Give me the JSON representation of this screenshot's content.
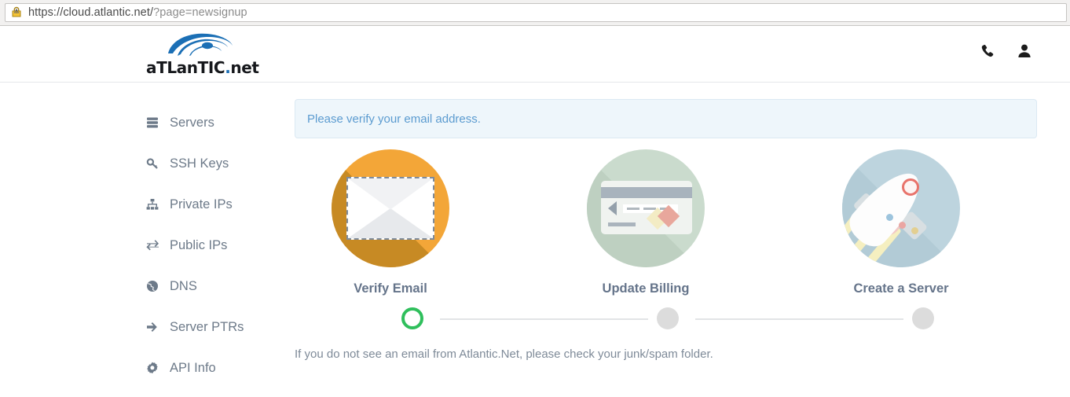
{
  "browser": {
    "url_secure_part": "https://cloud.atlantic.net/",
    "url_query_part": "?page=newsignup",
    "lock_icon": "warning-lock-icon"
  },
  "header": {
    "brand_name": "aTLanTIC",
    "brand_suffix": "net",
    "brand_dot": ".",
    "logo_icon": "atlantic-swoosh-logo",
    "actions": [
      {
        "name": "phone-support",
        "icon": "phone-icon"
      },
      {
        "name": "user-account",
        "icon": "user-icon"
      }
    ]
  },
  "sidebar": {
    "items": [
      {
        "label": "Servers",
        "icon": "server-stack-icon"
      },
      {
        "label": "SSH Keys",
        "icon": "key-icon"
      },
      {
        "label": "Private IPs",
        "icon": "sitemap-icon"
      },
      {
        "label": "Public IPs",
        "icon": "exchange-arrows-icon"
      },
      {
        "label": "DNS",
        "icon": "globe-icon"
      },
      {
        "label": "Server PTRs",
        "icon": "arrow-right-icon"
      },
      {
        "label": "API Info",
        "icon": "gear-icon"
      }
    ]
  },
  "main": {
    "alert": {
      "text": "Please verify your email address.",
      "type": "info",
      "bg_color": "#eef6fb",
      "text_color": "#5b9bd0"
    },
    "steps": [
      {
        "label": "Verify Email",
        "illustration": "envelope-illustration",
        "circle_color": "#f3a638",
        "state": "active"
      },
      {
        "label": "Update Billing",
        "illustration": "credit-card-illustration",
        "circle_color": "#cadbcd",
        "state": "pending"
      },
      {
        "label": "Create a Server",
        "illustration": "rocket-illustration",
        "circle_color": "#bdd4de",
        "state": "pending"
      }
    ],
    "progress": {
      "active_color": "#2fbf5c",
      "idle_color": "#dcdcdc",
      "nodes": [
        "active",
        "idle",
        "idle"
      ]
    },
    "note": "If you do not see an email from Atlantic.Net, please check your junk/spam folder."
  }
}
